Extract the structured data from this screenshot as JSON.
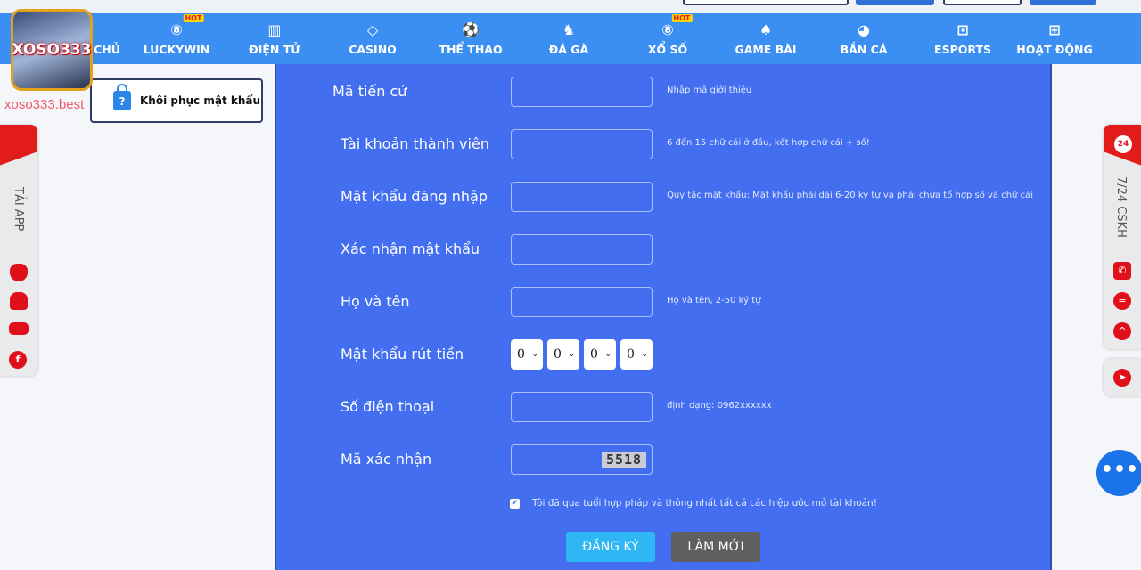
{
  "site_name": "xoso333.best",
  "logo_text": "XOSO333",
  "nav": [
    {
      "label": "CHỦ",
      "icon": "home-icon",
      "glyph": ""
    },
    {
      "label": "LUCKYWIN",
      "icon": "lottery-ball-icon",
      "glyph": "⑧",
      "badge": "HOT"
    },
    {
      "label": "ĐIỆN TỬ",
      "icon": "slot-machine-icon",
      "glyph": "▥"
    },
    {
      "label": "CASINO",
      "icon": "diamond-icon",
      "glyph": "◇"
    },
    {
      "label": "THỂ THAO",
      "icon": "soccer-ball-icon",
      "glyph": "⚽"
    },
    {
      "label": "ĐÁ GÀ",
      "icon": "rooster-icon",
      "glyph": "♞"
    },
    {
      "label": "XỔ SỐ",
      "icon": "lottery-ball-icon",
      "glyph": "⑧",
      "badge": "HOT"
    },
    {
      "label": "GAME BÀI",
      "icon": "cards-icon",
      "glyph": "♠"
    },
    {
      "label": "BẮN CÁ",
      "icon": "fish-icon",
      "glyph": "◕"
    },
    {
      "label": "ESPORTS",
      "icon": "gamepad-icon",
      "glyph": "⊡"
    },
    {
      "label": "HOẠT ĐỘNG",
      "icon": "gift-icon",
      "glyph": "⊞"
    }
  ],
  "recover_label": "Khôi phục mật khẩu",
  "form": {
    "rows": [
      {
        "label": "Mã tiến cử",
        "hint": "Nhập mã giới thiệu"
      },
      {
        "label": "Tài khoản thành viên",
        "hint": "6 đến 15 chữ cái ở đầu, kết hợp chữ cái + số!"
      },
      {
        "label": "Mật khẩu đăng nhập",
        "hint": "Quy tắc mật khẩu: Mật khẩu phải dài 6-20 ký tự và phải chứa tổ hợp số và chữ cái"
      },
      {
        "label": "Xác nhận mật khẩu",
        "hint": ""
      },
      {
        "label": "Họ và tên",
        "hint": "Họ và tên, 2-50 ký tự"
      },
      {
        "label": "Mật khẩu rút tiền",
        "hint": ""
      },
      {
        "label": "Số điện thoại",
        "hint": "định dạng: 0962xxxxxx"
      },
      {
        "label": "Mã xác nhận",
        "hint": ""
      }
    ],
    "pin_values": [
      "0",
      "0",
      "0",
      "0"
    ],
    "captcha": "5518",
    "agree_text": "Tôi đã qua tuổi hợp pháp và thông nhất tất cả các hiệp ước mở tài khoản!",
    "agree_checked": true,
    "register_label": "ĐĂNG KÝ",
    "reset_label": "LÀM MỚI"
  },
  "left_sidebar": {
    "label": "TẢI APP",
    "icons": [
      "apple-icon",
      "android-icon",
      "gamepad-icon",
      "facebook-icon"
    ]
  },
  "right_sidebar": {
    "label": "7/24 CSKH",
    "badge": "24",
    "icons": [
      "phone-icon",
      "message-icon",
      "chevron-up-icon",
      "telegram-icon"
    ]
  },
  "colors": {
    "nav": "#3b8ff2",
    "panel": "#436ef0",
    "register": "#2fb6f5",
    "reset": "#5f5f5f",
    "accent_red": "#e0101a"
  }
}
